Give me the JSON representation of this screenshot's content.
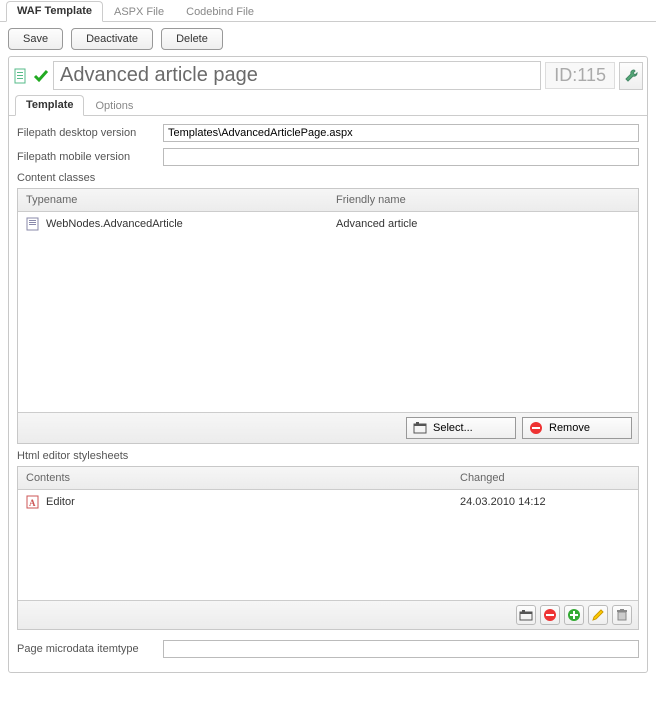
{
  "top_tabs": {
    "waf_template": "WAF Template",
    "aspx_file": "ASPX File",
    "codebind_file": "Codebind File"
  },
  "toolbar": {
    "save": "Save",
    "deactivate": "Deactivate",
    "delete": "Delete"
  },
  "title_bar": {
    "title": "Advanced article page",
    "id_label": "ID:",
    "id_value": "115"
  },
  "inner_tabs": {
    "template": "Template",
    "options": "Options"
  },
  "form": {
    "filepath_desktop_label": "Filepath desktop version",
    "filepath_desktop_value": "Templates\\AdvancedArticlePage.aspx",
    "filepath_mobile_label": "Filepath mobile version",
    "filepath_mobile_value": ""
  },
  "content_classes": {
    "section_label": "Content classes",
    "columns": {
      "typename": "Typename",
      "friendly": "Friendly name"
    },
    "rows": [
      {
        "typename": "WebNodes.AdvancedArticle",
        "friendly": "Advanced article"
      }
    ],
    "footer": {
      "select": "Select...",
      "remove": "Remove"
    }
  },
  "html_editor": {
    "section_label": "Html editor stylesheets",
    "columns": {
      "contents": "Contents",
      "changed": "Changed"
    },
    "rows": [
      {
        "contents": "Editor",
        "changed": "24.03.2010 14:12"
      }
    ]
  },
  "microdata": {
    "label": "Page microdata itemtype",
    "value": ""
  }
}
